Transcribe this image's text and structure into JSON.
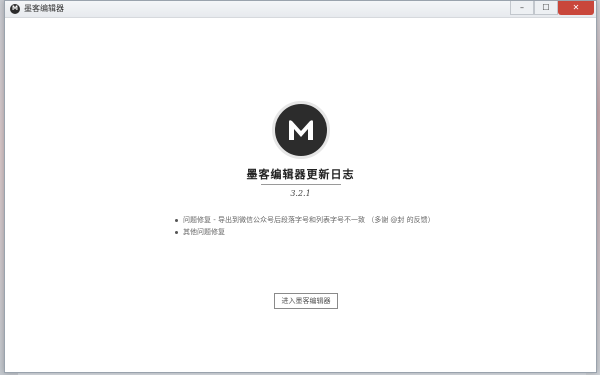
{
  "window": {
    "title": "墨客编辑器",
    "app_icon_glyph": "M",
    "controls": {
      "minimize": "–",
      "maximize": "☐",
      "close": "✕"
    }
  },
  "changelog": {
    "logo_letter": "M",
    "heading": "墨客编辑器更新日志",
    "version": "3.2.1",
    "notes": [
      "问题修复 - 导出到微信公众号后段落字号和列表字号不一致 （多谢 @封 的反馈）",
      "其他问题修复"
    ]
  },
  "actions": {
    "enter_button": "进入墨客编辑器"
  },
  "colors": {
    "logo_bg": "#2c2c2c",
    "close_button": "#c9473b",
    "content_bg": "#ffffff"
  }
}
